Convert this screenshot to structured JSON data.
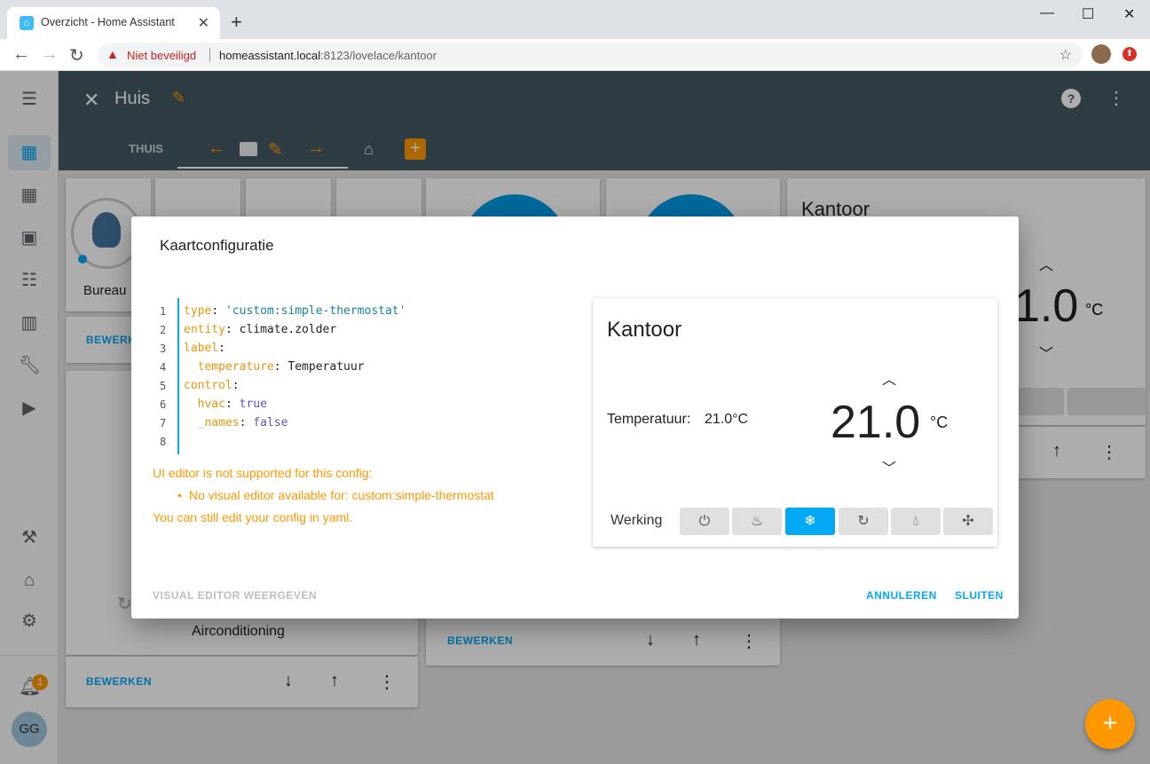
{
  "browser": {
    "tab_title": "Overzicht - Home Assistant",
    "insecure_label": "Niet beveiligd",
    "url_host": "homeassistant.local",
    "url_rest": ":8123/lovelace/kantoor"
  },
  "header": {
    "title": "Huis",
    "tab_label": "THUIS"
  },
  "sidebar": {
    "notification_count": "1",
    "user_initials": "GG"
  },
  "background": {
    "card1_label": "Bureau",
    "card_edit_label": "BEWERKEN",
    "aircon_label": "Airconditioning",
    "kantoor_title": "Kantoor",
    "kantoor_temp": "1.0",
    "unit": "°C"
  },
  "dialog": {
    "title": "Kaartconfiguratie",
    "code_lines": [
      "1",
      "2",
      "3",
      "4",
      "5",
      "6",
      "7",
      "8"
    ],
    "warning_line1": "UI editor is not supported for this config:",
    "warning_item": "No visual editor available for: custom:simple-thermostat",
    "warning_line2": "You can still edit your config in yaml.",
    "btn_visual": "VISUAL EDITOR WEERGEVEN",
    "btn_cancel": "ANNULEREN",
    "btn_close": "SLUITEN"
  },
  "preview": {
    "name": "Kantoor",
    "sensor_label": "Temperatuur:",
    "sensor_value": "21.0°C",
    "target": "21.0",
    "unit": "°C",
    "mode_label": "Werking",
    "active_mode": "cool"
  },
  "colors": {
    "header": "#455a64",
    "accent": "#ff9800",
    "primary": "#03a9f4"
  }
}
